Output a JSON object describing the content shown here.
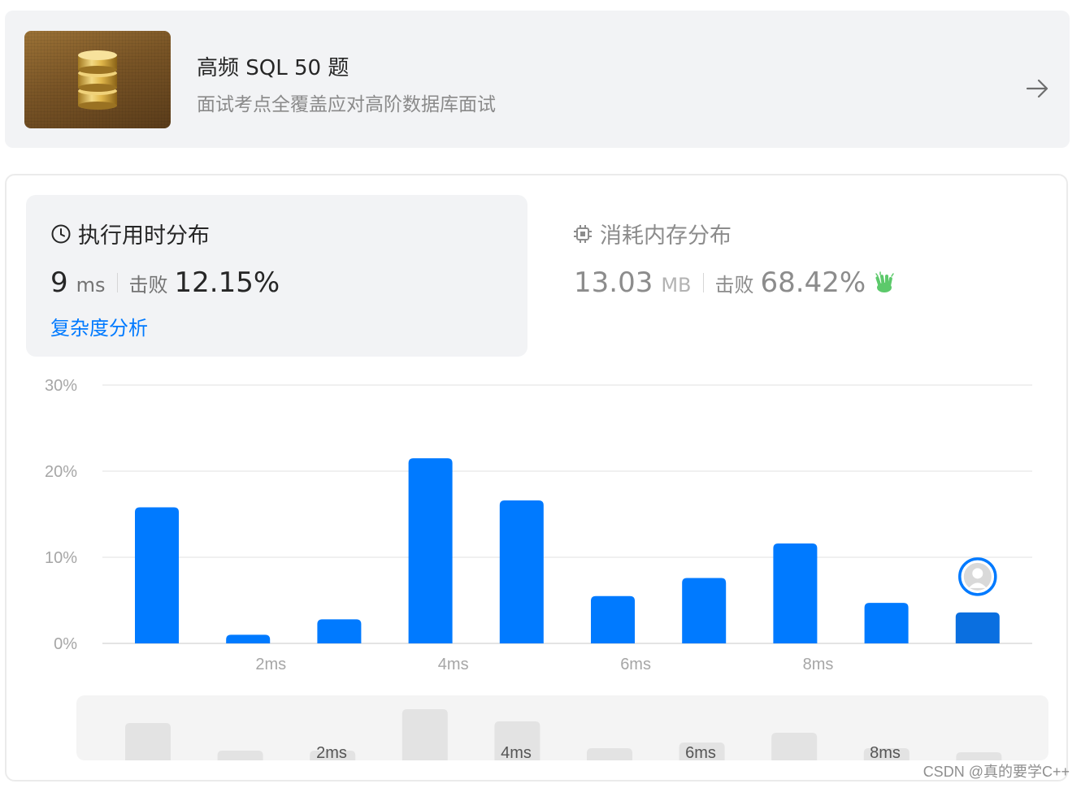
{
  "study_plan": {
    "title": "高频 SQL 50 题",
    "subtitle": "面试考点全覆盖应对高阶数据库面试",
    "image_icon": "database-icon"
  },
  "runtime": {
    "heading": "执行用时分布",
    "value": "9",
    "unit": "ms",
    "beat_label": "击败",
    "beat_value": "12.15%",
    "link": "复杂度分析",
    "icon": "clock-icon"
  },
  "memory": {
    "heading": "消耗内存分布",
    "value": "13.03",
    "unit": "MB",
    "beat_label": "击败",
    "beat_value": "68.42%",
    "icon": "chip-icon",
    "badge_icon": "clap-icon",
    "badge_color": "#5cc96b"
  },
  "colors": {
    "accent": "#007aff",
    "selected_bar": "#0a6fe0",
    "overview_bar": "#e3e3e3"
  },
  "chart_data": {
    "type": "bar",
    "ylim": [
      0,
      30
    ],
    "y_ticks": [
      "0%",
      "10%",
      "20%",
      "30%"
    ],
    "x_ticks": [
      {
        "label": "2ms",
        "after_bar": 2
      },
      {
        "label": "4ms",
        "after_bar": 4
      },
      {
        "label": "6ms",
        "after_bar": 6
      },
      {
        "label": "8ms",
        "after_bar": 8
      }
    ],
    "values": [
      15.8,
      1.0,
      2.8,
      21.5,
      16.6,
      5.5,
      7.6,
      11.6,
      4.7,
      3.6
    ],
    "selected_index": 9,
    "grid": true,
    "overview": {
      "values": [
        4.6,
        1.2,
        1.2,
        6.3,
        4.8,
        1.5,
        2.2,
        3.4,
        1.5,
        1.0
      ],
      "x_ticks": [
        "2ms",
        "4ms",
        "6ms",
        "8ms"
      ]
    }
  },
  "watermark": "CSDN @真的要学C++"
}
